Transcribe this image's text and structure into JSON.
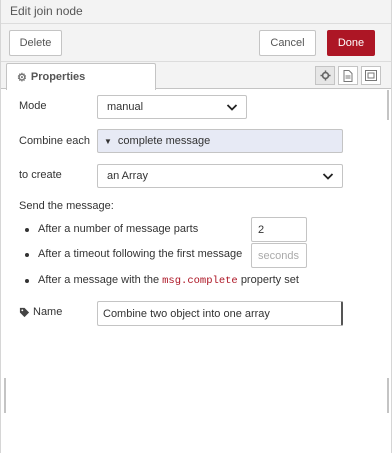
{
  "window": {
    "title": "Edit join node"
  },
  "toolbar": {
    "delete_label": "Delete",
    "cancel_label": "Cancel",
    "done_label": "Done"
  },
  "tabs": {
    "properties_label": "Properties",
    "icons": [
      "gear-icon",
      "description-icon",
      "appearance-icon"
    ]
  },
  "form": {
    "mode": {
      "label": "Mode",
      "value": "manual"
    },
    "combine": {
      "label": "Combine each",
      "value": "complete message"
    },
    "create": {
      "label": "to create",
      "value": "an Array"
    },
    "send": {
      "heading": "Send the message:",
      "items": [
        {
          "text": "After a number of message parts",
          "value": "2",
          "placeholder": ""
        },
        {
          "text": "After a timeout following the first message",
          "value": "",
          "placeholder": "seconds"
        }
      ],
      "complete_prefix": "After a message with the",
      "complete_code": "msg.complete",
      "complete_suffix": "property set"
    },
    "name": {
      "label": "Name",
      "value": "Combine two object into one array"
    }
  },
  "colors": {
    "done_button": "#ad1625",
    "code_text": "#ad1625",
    "combine_bg": "#e7eaf5"
  }
}
